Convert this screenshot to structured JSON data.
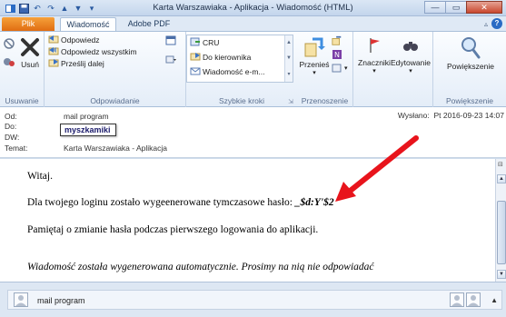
{
  "window": {
    "title": "Karta Warszawiaka - Aplikacja - Wiadomość (HTML)"
  },
  "tabs": {
    "file": "Plik",
    "message": "Wiadomość",
    "adobe": "Adobe PDF"
  },
  "ribbon": {
    "groups": {
      "delete": "Usuwanie",
      "respond": "Odpowiadanie",
      "quick_steps": "Szybkie kroki",
      "move": "Przenoszenie",
      "zoom": "Powiększenie"
    },
    "delete_label": "Usuń",
    "reply": "Odpowiedz",
    "reply_all": "Odpowiedz wszystkim",
    "forward": "Prześlij dalej",
    "quick_steps": [
      "CRU",
      "Do kierownika",
      "Wiadomość e-m..."
    ],
    "move": "Przenieś",
    "tags": "Znaczniki",
    "editing": "Edytowanie",
    "zoom": "Powiększenie"
  },
  "header": {
    "from_label": "Od:",
    "from_value": "mail program",
    "to_label": "Do:",
    "to_tooltip": "myszkamiki",
    "cc_label": "DW:",
    "subject_label": "Temat:",
    "subject_value": "Karta Warszawiaka - Aplikacja",
    "sent_label": "Wysłano:",
    "sent_value": "Pt 2016-09-23 14:07"
  },
  "body": {
    "greeting": "Witaj.",
    "line1": "Dla twojego loginu zostało wygeenerowane tymczasowe hasło: ",
    "password": "_$d:Y'$2",
    "line2": "Pamiętaj o zmianie hasła podczas pierwszego logowania do aplikacji.",
    "footer": "Wiadomość została wygenerowana automatycznie. Prosimy na nią nie odpowiadać"
  },
  "people_pane": {
    "name": "mail program"
  },
  "colors": {
    "file_tab": "#e06d12",
    "arrow": "#e8141c",
    "accent": "#2a6bc4"
  }
}
